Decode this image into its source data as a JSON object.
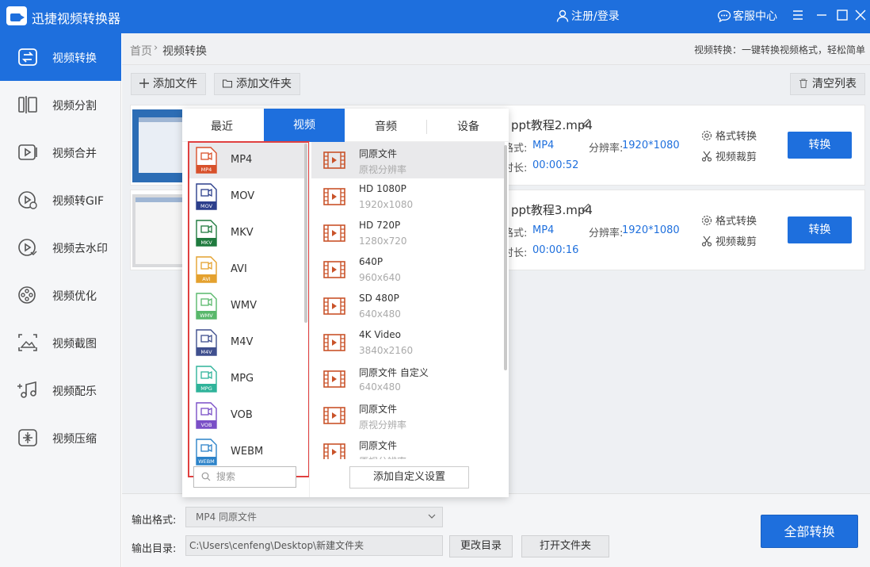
{
  "window": {
    "title": "迅捷视频转换器",
    "login_label": "注册/登录",
    "service_label": "客服中心"
  },
  "sidebar": {
    "items": [
      {
        "label": "视频转换",
        "icon": "swap-icon"
      },
      {
        "label": "视频分割",
        "icon": "split-icon"
      },
      {
        "label": "视频合并",
        "icon": "merge-icon"
      },
      {
        "label": "视频转GIF",
        "icon": "gif-icon"
      },
      {
        "label": "视频去水印",
        "icon": "watermark-icon"
      },
      {
        "label": "视频优化",
        "icon": "film-reel-icon"
      },
      {
        "label": "视频截图",
        "icon": "screenshot-icon"
      },
      {
        "label": "视频配乐",
        "icon": "music-icon"
      },
      {
        "label": "视频压缩",
        "icon": "compress-icon"
      }
    ]
  },
  "breadcrumb": {
    "home": "首页",
    "current": "视频转换"
  },
  "tagline": "视频转换：一键转换视频格式，轻松简单",
  "toolbar": {
    "add_file": "添加文件",
    "add_folder": "添加文件夹",
    "clear_list": "清空列表"
  },
  "files": [
    {
      "name": "ppt教程2.mp4",
      "format_label": "格式:",
      "format": "MP4",
      "resolution_label": "分辨率:",
      "resolution": "1920*1080",
      "duration_label": "时长:",
      "duration": "00:00:52",
      "op_format": "格式转换",
      "op_cut": "视频裁剪",
      "convert": "转换"
    },
    {
      "name": "ppt教程3.mp4",
      "format_label": "格式:",
      "format": "MP4",
      "resolution_label": "分辨率:",
      "resolution": "1920*1080",
      "duration_label": "时长:",
      "duration": "00:00:16",
      "op_format": "格式转换",
      "op_cut": "视频裁剪",
      "convert": "转换"
    }
  ],
  "popup": {
    "tabs": [
      "最近",
      "视频",
      "音频",
      "设备"
    ],
    "active_tab": "视频",
    "formats": [
      {
        "name": "MP4",
        "color": "#d8512b"
      },
      {
        "name": "MOV",
        "color": "#2c3f8c"
      },
      {
        "name": "MKV",
        "color": "#1f7a3e"
      },
      {
        "name": "AVI",
        "color": "#e4a12e"
      },
      {
        "name": "WMV",
        "color": "#59b86b"
      },
      {
        "name": "M4V",
        "color": "#3f4f8e"
      },
      {
        "name": "MPG",
        "color": "#2fb39a"
      },
      {
        "name": "VOB",
        "color": "#7a4fc7"
      },
      {
        "name": "WEBM",
        "color": "#2c83c9"
      }
    ],
    "selected_format": "MP4",
    "presets": [
      {
        "name": "同原文件",
        "sub": "原视分辨率"
      },
      {
        "name": "HD 1080P",
        "sub": "1920x1080"
      },
      {
        "name": "HD 720P",
        "sub": "1280x720"
      },
      {
        "name": "640P",
        "sub": "960x640"
      },
      {
        "name": "SD 480P",
        "sub": "640x480"
      },
      {
        "name": "4K Video",
        "sub": "3840x2160"
      },
      {
        "name": "同原文件 自定义",
        "sub": "640x480"
      },
      {
        "name": "同原文件",
        "sub": "原视分辨率"
      },
      {
        "name": "同原文件",
        "sub": "原视分辨率"
      }
    ],
    "search_placeholder": "搜索",
    "add_custom": "添加自定义设置"
  },
  "bottom": {
    "output_format_label": "输出格式:",
    "output_format_value": "MP4  同原文件",
    "output_dir_label": "输出目录:",
    "output_dir_value": "C:\\Users\\cenfeng\\Desktop\\新建文件夹",
    "change_dir": "更改目录",
    "open_folder": "打开文件夹",
    "convert_all": "全部转换"
  },
  "colors": {
    "accent": "#1e6fdd",
    "highlight_box": "#e04040"
  }
}
